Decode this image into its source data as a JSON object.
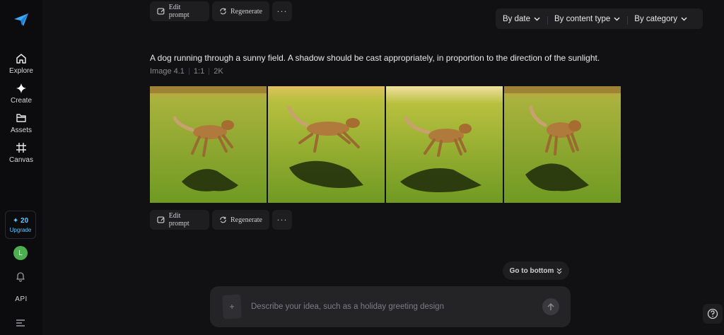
{
  "sidebar": {
    "logo_icon": "paper-plane-logo",
    "items": [
      {
        "label": "Explore",
        "icon": "home-icon"
      },
      {
        "label": "Create",
        "icon": "sparkle-icon"
      },
      {
        "label": "Assets",
        "icon": "folder-icon"
      },
      {
        "label": "Canvas",
        "icon": "canvas-icon"
      }
    ],
    "credits": "✦ 20",
    "upgrade_label": "Upgrade",
    "avatar_initial": "L",
    "api_label": "API"
  },
  "top_actions": {
    "edit_prompt": "Edit prompt",
    "regenerate": "Regenerate",
    "more": "···"
  },
  "filters": [
    {
      "label": "By date"
    },
    {
      "label": "By content type"
    },
    {
      "label": "By category"
    }
  ],
  "generation": {
    "prompt": "A dog running through a sunny field. A shadow should be cast appropriately, in proportion to the direction of the sunlight.",
    "model": "Image 4.1",
    "ratio": "1:1",
    "resolution": "2K",
    "image_count": 4
  },
  "bottom_actions": {
    "edit_prompt": "Edit prompt",
    "regenerate": "Regenerate",
    "more": "···"
  },
  "go_to_bottom": "Go to bottom",
  "composer": {
    "placeholder": "Describe your idea, such as a holiday greeting design",
    "add_icon": "+"
  },
  "colors": {
    "background": "#111113",
    "sidebar": "#0c0c0e",
    "panel": "#1e1e21",
    "accent": "#5ec8ff",
    "avatar": "#4caf50"
  }
}
